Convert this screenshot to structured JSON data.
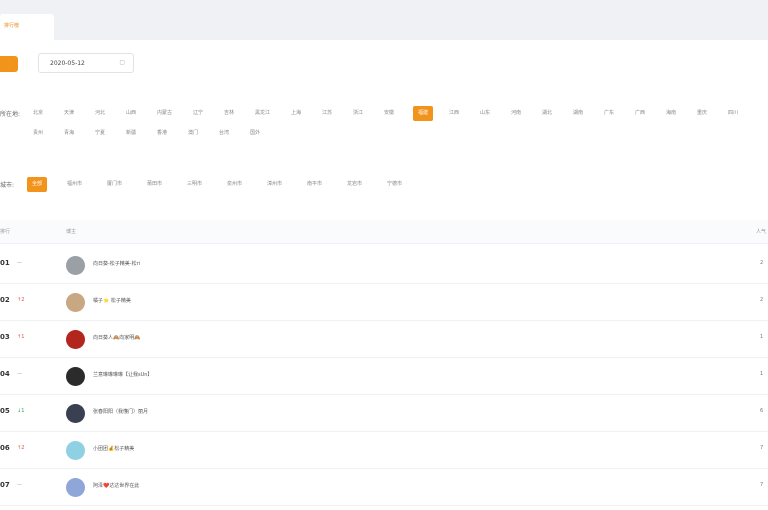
{
  "tab": {
    "label": "排行榜"
  },
  "controls": {
    "button_label": "",
    "date_value": "2020-05-12",
    "calendar_glyph": "▢",
    "right_link": ""
  },
  "region_filter": {
    "label": "所在地:",
    "rows": [
      [
        {
          "label": "北京",
          "active": false
        },
        {
          "label": "天津",
          "active": false
        },
        {
          "label": "河北",
          "active": false
        },
        {
          "label": "山西",
          "active": false
        },
        {
          "label": "内蒙古",
          "active": false
        },
        {
          "label": "辽宁",
          "active": false
        },
        {
          "label": "吉林",
          "active": false
        },
        {
          "label": "黑龙江",
          "active": false
        },
        {
          "label": "上海",
          "active": false
        },
        {
          "label": "江苏",
          "active": false
        },
        {
          "label": "浙江",
          "active": false
        },
        {
          "label": "安徽",
          "active": false
        },
        {
          "label": "福建",
          "active": true
        },
        {
          "label": "江西",
          "active": false
        },
        {
          "label": "山东",
          "active": false
        },
        {
          "label": "河南",
          "active": false
        },
        {
          "label": "湖北",
          "active": false
        },
        {
          "label": "湖南",
          "active": false
        },
        {
          "label": "广东",
          "active": false
        },
        {
          "label": "广西",
          "active": false
        },
        {
          "label": "海南",
          "active": false
        },
        {
          "label": "重庆",
          "active": false
        },
        {
          "label": "四川",
          "active": false
        }
      ],
      [
        {
          "label": "贵州",
          "active": false
        },
        {
          "label": "青海",
          "active": false
        },
        {
          "label": "宁夏",
          "active": false
        },
        {
          "label": "新疆",
          "active": false
        },
        {
          "label": "香港",
          "active": false
        },
        {
          "label": "澳门",
          "active": false
        },
        {
          "label": "台湾",
          "active": false
        },
        {
          "label": "国外",
          "active": false
        }
      ]
    ]
  },
  "city_filter": {
    "label": "城市:",
    "chips": [
      {
        "label": "全部",
        "active": true
      },
      {
        "label": "福州市",
        "active": false
      },
      {
        "label": "厦门市",
        "active": false
      },
      {
        "label": "莆田市",
        "active": false
      },
      {
        "label": "三明市",
        "active": false
      },
      {
        "label": "泉州市",
        "active": false
      },
      {
        "label": "漳州市",
        "active": false
      },
      {
        "label": "南平市",
        "active": false
      },
      {
        "label": "龙岩市",
        "active": false
      },
      {
        "label": "宁德市",
        "active": false
      }
    ]
  },
  "table": {
    "headers": {
      "rank": "排行",
      "name": "博主",
      "value": "人气"
    },
    "rows": [
      {
        "rank": "01",
        "trend": "—",
        "trend_color": "#999999",
        "avatar_color": "#9aa0a6",
        "name": "向日葵-松子精美-松ri",
        "value": "2"
      },
      {
        "rank": "02",
        "trend": "↑2",
        "trend_color": "#e0533b",
        "avatar_color": "#c8a882",
        "name": "橘子⭐ 松子精美",
        "value": "2"
      },
      {
        "rank": "03",
        "trend": "↑1",
        "trend_color": "#e0533b",
        "avatar_color": "#b3261e",
        "name": "向日葵人🙈向家明🙈",
        "value": "1"
      },
      {
        "rank": "04",
        "trend": "—",
        "trend_color": "#999999",
        "avatar_color": "#2b2b2b",
        "name": "兰意琳琳琳琳【让我sUn】",
        "value": "1"
      },
      {
        "rank": "05",
        "trend": "↓1",
        "trend_color": "#3aa05c",
        "avatar_color": "#3a3f52",
        "name": "张春阳阳（我懂门）丽月",
        "value": "6"
      },
      {
        "rank": "06",
        "trend": "↑2",
        "trend_color": "#e0533b",
        "avatar_color": "#8fd0e2",
        "name": "小团团💰松子精美",
        "value": "7"
      },
      {
        "rank": "07",
        "trend": "—",
        "trend_color": "#999999",
        "avatar_color": "#8ea6d8",
        "name": "阿泽❤️达达世界在此",
        "value": "7"
      }
    ]
  }
}
